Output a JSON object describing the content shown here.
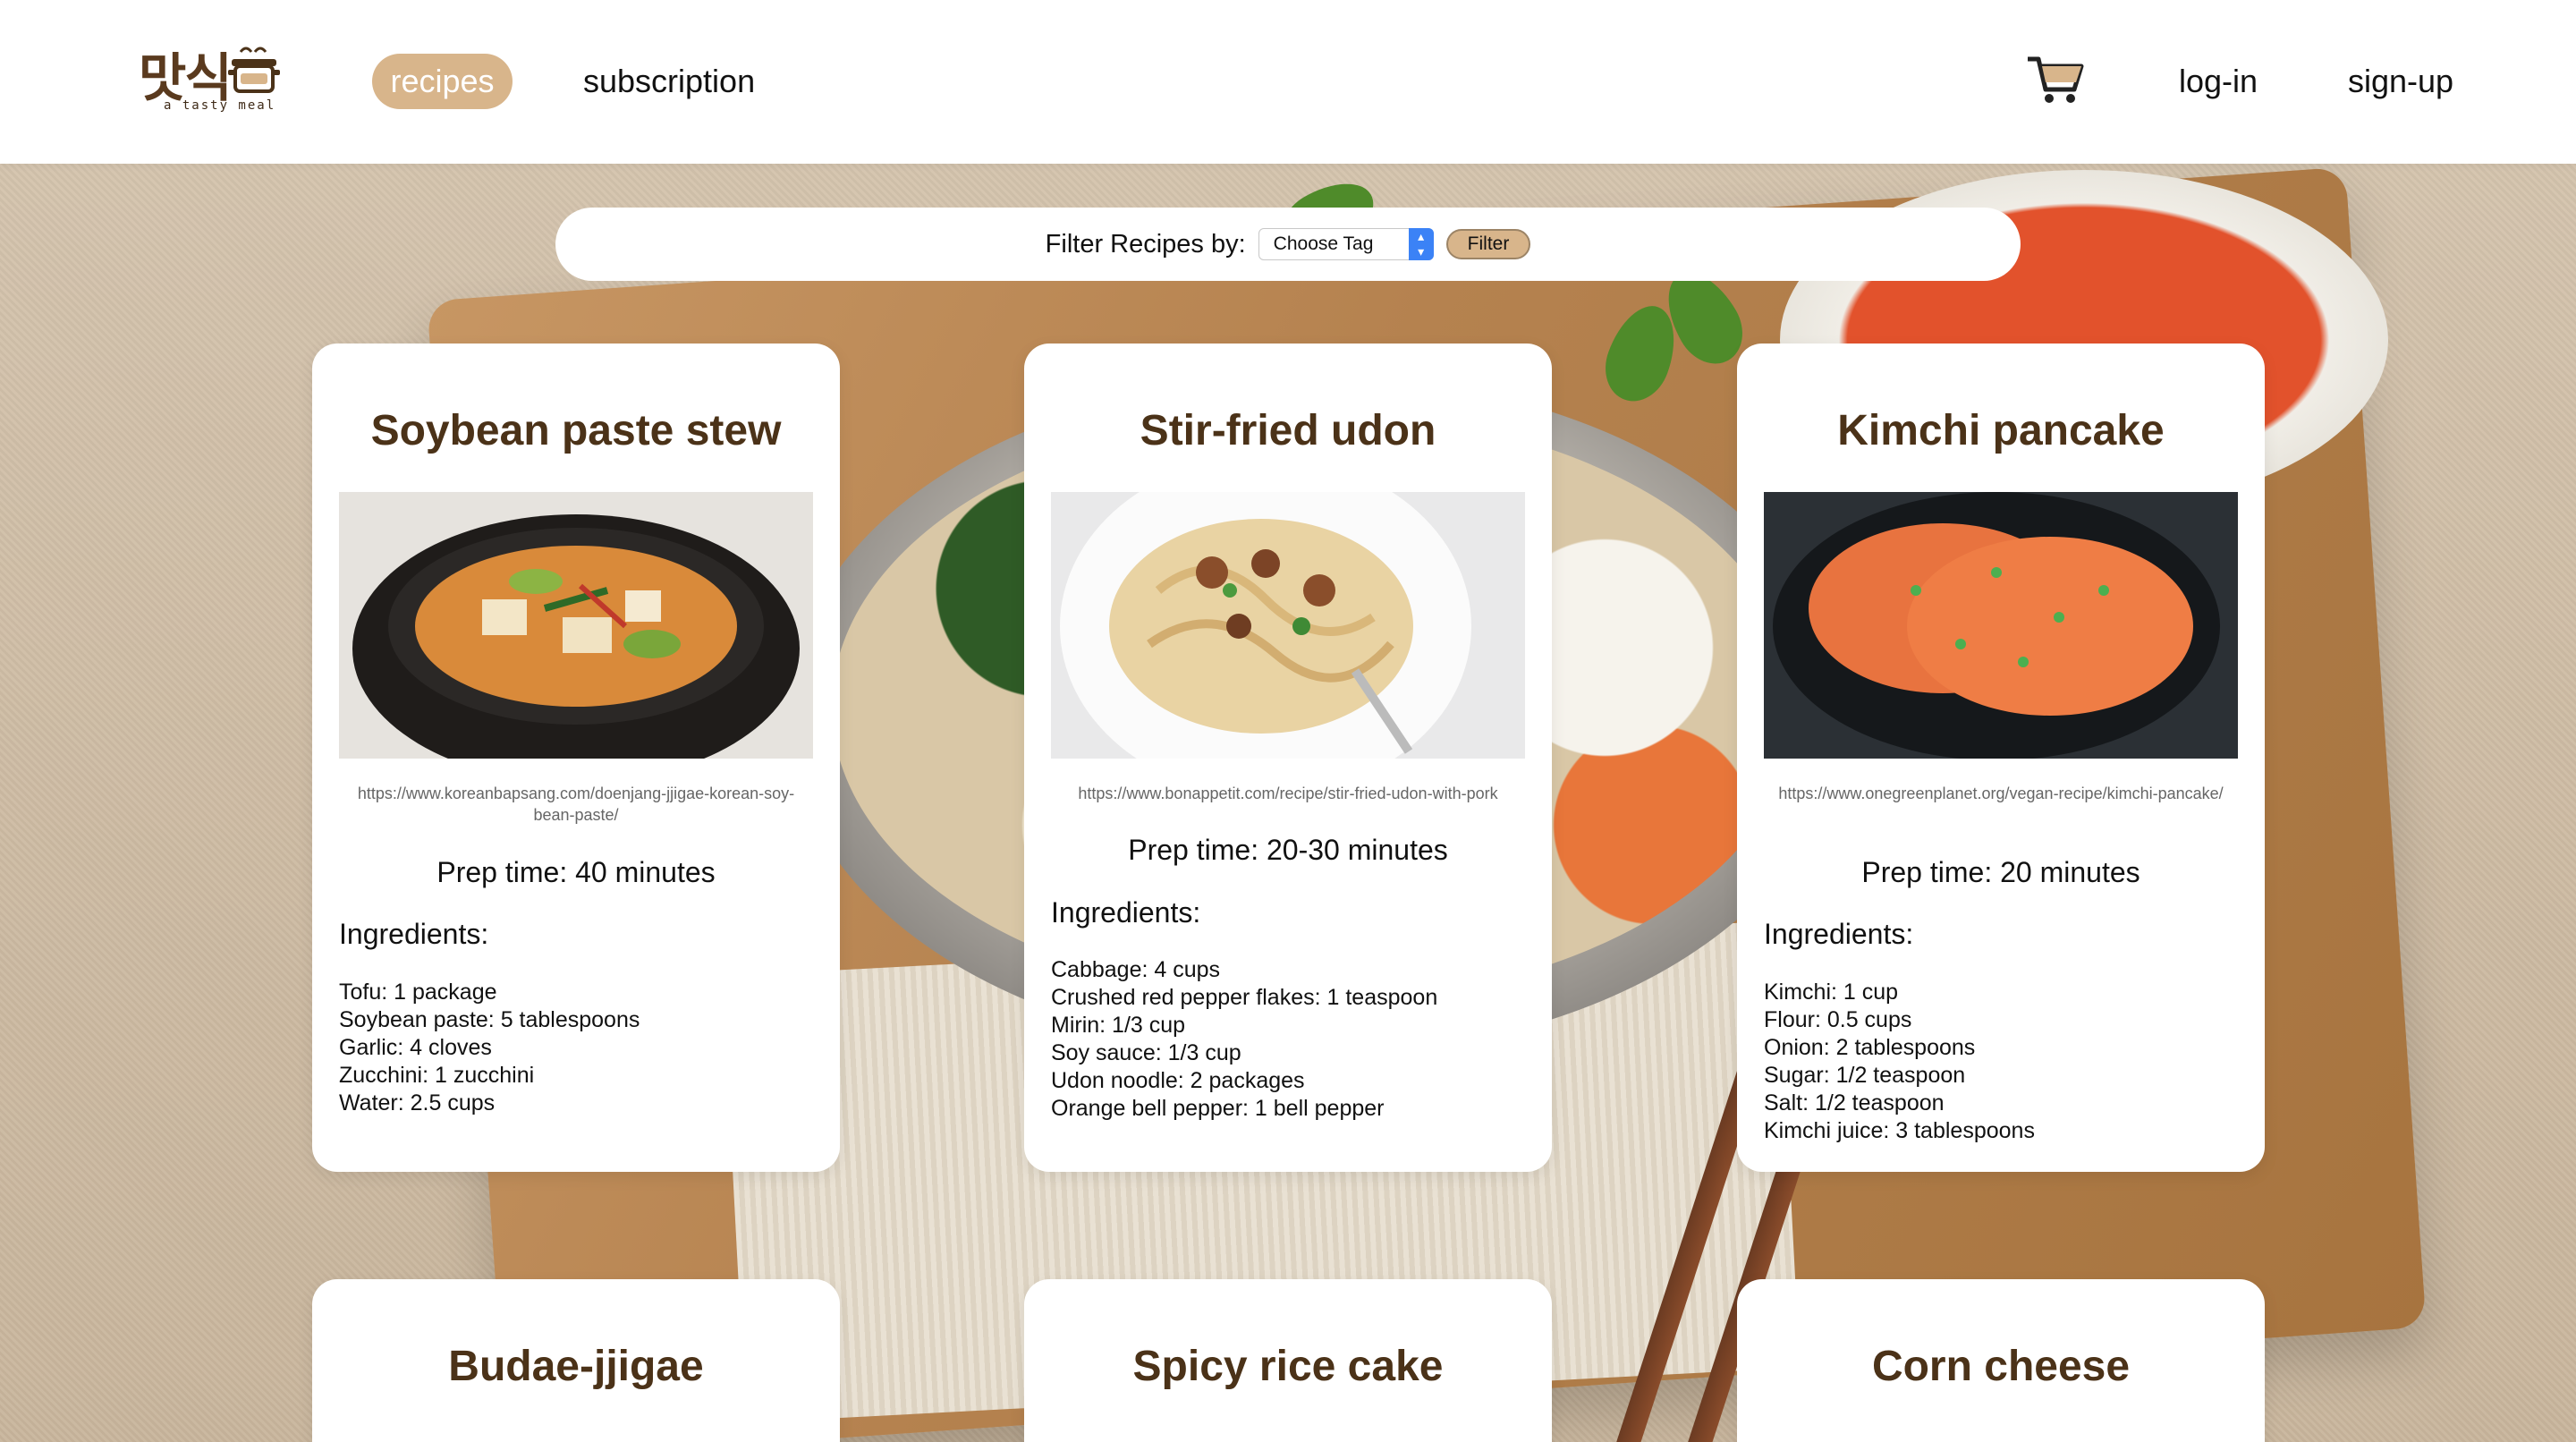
{
  "header": {
    "logo": {
      "word": "맛식",
      "tagline": "a tasty meal"
    },
    "nav": {
      "recipes": "recipes",
      "subscription": "subscription",
      "login": "log-in",
      "signup": "sign-up"
    },
    "icons": {
      "cart": "cart-icon",
      "pot": "pot-icon"
    }
  },
  "filter": {
    "label": "Filter Recipes by:",
    "select_value": "Choose Tag",
    "button": "Filter"
  },
  "colors": {
    "accent": "#d8b58b",
    "title": "#4b3218"
  },
  "recipes": [
    {
      "title": "Soybean paste stew",
      "url": "https://www.koreanbapsang.com/doenjang-jjigae-korean-soy-bean-paste/",
      "prep": "Prep time: 40 minutes",
      "ingredients_heading": "Ingredients:",
      "ingredients": [
        "Tofu: 1 package",
        "Soybean paste: 5 tablespoons",
        "Garlic: 4 cloves",
        "Zucchini: 1 zucchini",
        "Water: 2.5 cups"
      ]
    },
    {
      "title": "Stir-fried udon",
      "url": "https://www.bonappetit.com/recipe/stir-fried-udon-with-pork",
      "prep": "Prep time: 20-30 minutes",
      "ingredients_heading": "Ingredients:",
      "ingredients": [
        "Cabbage: 4 cups",
        "Crushed red pepper flakes: 1 teaspoon",
        "Mirin: 1/3 cup",
        "Soy sauce: 1/3 cup",
        "Udon noodle: 2 packages",
        "Orange bell pepper: 1 bell pepper"
      ]
    },
    {
      "title": "Kimchi pancake",
      "url": "https://www.onegreenplanet.org/vegan-recipe/kimchi-pancake/",
      "prep": "Prep time: 20 minutes",
      "ingredients_heading": "Ingredients:",
      "ingredients": [
        "Kimchi: 1 cup",
        "Flour: 0.5 cups",
        "Onion: 2 tablespoons",
        "Sugar: 1/2 teaspoon",
        "Salt: 1/2 teaspoon",
        "Kimchi juice: 3 tablespoons"
      ]
    },
    {
      "title": "Budae-jjigae"
    },
    {
      "title": "Spicy rice cake"
    },
    {
      "title": "Corn cheese"
    }
  ]
}
